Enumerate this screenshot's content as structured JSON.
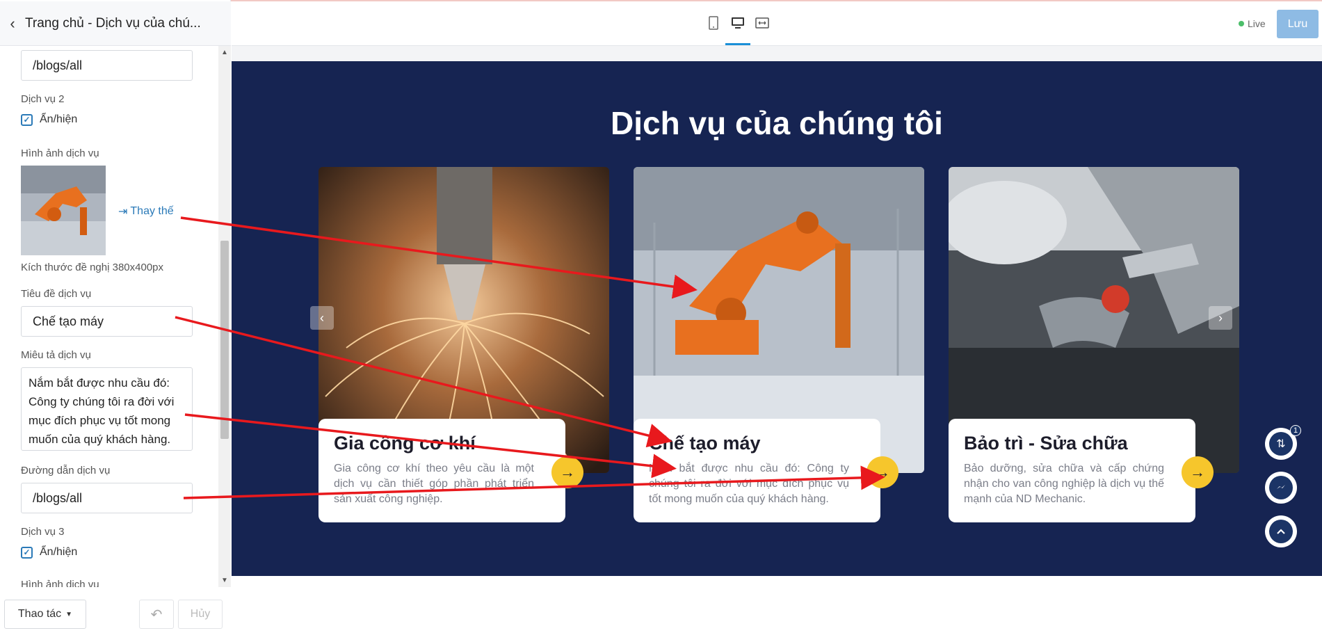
{
  "header": {
    "back_icon": "chevron-left-icon",
    "page_title": "Trang chủ - Dịch vụ của chú..."
  },
  "toolbar": {
    "devices": [
      "mobile-icon",
      "desktop-icon",
      "fullwidth-icon"
    ],
    "active_device": "desktop",
    "live_label": "Live",
    "save_label": "Lưu"
  },
  "sidebar": {
    "prev_link_value": "/blogs/all",
    "service2": {
      "heading": "Dịch vụ 2",
      "toggle_label": "Ẩn/hiện",
      "image_label": "Hình ảnh dịch vụ",
      "replace_label": "Thay thế",
      "size_hint": "Kích thước đề nghị 380x400px",
      "title_label": "Tiêu đề dịch vụ",
      "title_value": "Chế tạo máy",
      "desc_label": "Miêu tả dịch vụ",
      "desc_value": "Nắm bắt được nhu cầu đó: Công ty chúng tôi ra đời với mục đích phục vụ tốt mong muốn của quý khách hàng.",
      "link_label": "Đường dẫn dịch vụ",
      "link_value": "/blogs/all"
    },
    "service3": {
      "heading": "Dịch vụ 3",
      "toggle_label": "Ẩn/hiện",
      "image_label": "Hình ảnh dịch vụ"
    }
  },
  "footer": {
    "actions_label": "Thao tác",
    "undo_icon": "undo-icon",
    "cancel_label": "Hủy"
  },
  "canvas": {
    "section_title": "Dịch vụ của chúng tôi",
    "cards": [
      {
        "title": "Gia công cơ khí",
        "desc": "Gia công cơ khí theo yêu cầu là một dịch vụ cần thiết góp phần phát triển sản xuất công nghiệp."
      },
      {
        "title": "Chế tạo máy",
        "desc": "Nắm bắt được nhu cầu đó: Công ty chúng tôi ra đời với mục đích phục vụ tốt mong muốn của quý khách hàng."
      },
      {
        "title": "Bảo trì - Sửa chữa",
        "desc": "Bảo dưỡng, sửa chữa và cấp chứng nhận cho van công nghiệp là dịch vụ thế mạnh của ND Mechanic."
      }
    ],
    "float_badge": "1"
  },
  "colors": {
    "section_bg": "#162452",
    "accent_yellow": "#f6c62c",
    "link_blue": "#2b7ab8",
    "annotation_red": "#e8191d"
  }
}
